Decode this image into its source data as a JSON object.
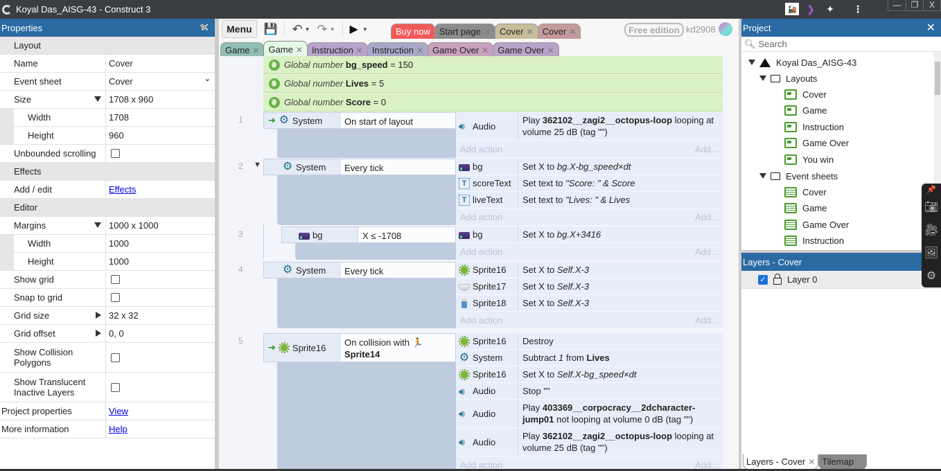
{
  "window": {
    "title": "Koyal Das_AISG-43 - Construct 3",
    "controls": [
      "minimize",
      "restore",
      "close"
    ]
  },
  "properties_panel": {
    "title": "Properties",
    "rows": [
      {
        "type": "section",
        "label": "Layout"
      },
      {
        "label": "Name",
        "value": "Cover"
      },
      {
        "label": "Event sheet",
        "value": "Cover",
        "control": "dropdown"
      },
      {
        "label": "Size",
        "value": "1708 x 960",
        "expander": "expanded"
      },
      {
        "label": "Width",
        "value": "1708",
        "sub": true
      },
      {
        "label": "Height",
        "value": "960",
        "sub": true
      },
      {
        "label": "Unbounded scrolling",
        "value": false,
        "control": "checkbox"
      },
      {
        "type": "section",
        "label": "Effects"
      },
      {
        "label": "Add / edit",
        "value": "Effects",
        "control": "link"
      },
      {
        "type": "section",
        "label": "Editor"
      },
      {
        "label": "Margins",
        "value": "1000 x 1000",
        "expander": "expanded"
      },
      {
        "label": "Width",
        "value": "1000",
        "sub": true
      },
      {
        "label": "Height",
        "value": "1000",
        "sub": true
      },
      {
        "label": "Show grid",
        "value": false,
        "control": "checkbox"
      },
      {
        "label": "Snap to grid",
        "value": false,
        "control": "checkbox"
      },
      {
        "label": "Grid size",
        "value": "32 x 32",
        "expander": "collapsed"
      },
      {
        "label": "Grid offset",
        "value": "0, 0",
        "expander": "collapsed"
      },
      {
        "label": "Show Collision Polygons",
        "value": false,
        "control": "checkbox"
      },
      {
        "label": "Show Translucent Inactive Layers",
        "value": false,
        "control": "checkbox"
      },
      {
        "label": "Project properties",
        "value": "View",
        "control": "link",
        "top": true
      },
      {
        "label": "More information",
        "value": "Help",
        "control": "link",
        "top": true
      }
    ]
  },
  "toolbar": {
    "menu_label": "Menu",
    "free_edition": "Free edition",
    "username": "kd2908"
  },
  "top_tabs": [
    {
      "label": "Buy now",
      "color": "#f25a5a",
      "closable": false,
      "text_color": "#ffffff"
    },
    {
      "label": "Start page",
      "color": "#8c8c8c",
      "closable": true
    },
    {
      "label": "Cover",
      "color": "#c8bd9a",
      "closable": true
    },
    {
      "label": "Cover",
      "color": "#c39a9a",
      "closable": true
    }
  ],
  "doc_tabs": [
    {
      "label": "Game",
      "color": "#8fbfb5",
      "active": false
    },
    {
      "label": "Game",
      "color": "#e6f9e6",
      "active": true
    },
    {
      "label": "Instruction",
      "color": "#b8a3cc",
      "active": false
    },
    {
      "label": "Instruction",
      "color": "#a9a8c9",
      "active": false
    },
    {
      "label": "Game Over",
      "color": "#c9a0be",
      "active": false
    },
    {
      "label": "Game Over",
      "color": "#b9a3c8",
      "active": false
    }
  ],
  "globals": [
    {
      "prefix": "Global number",
      "name": "bg_speed",
      "value": "= 150"
    },
    {
      "prefix": "Global number",
      "name": "Lives",
      "value": "= 5"
    },
    {
      "prefix": "Global number",
      "name": "Score",
      "value": "= 0"
    }
  ],
  "events": [
    {
      "num": "1",
      "trigger": true,
      "cond_obj": "System",
      "cond_icon": "gear",
      "cond": "On start of layout",
      "actions": [
        {
          "icon": "audio",
          "obj": "Audio",
          "pre": "Play ",
          "bold": "362102__zagi2__octopus-loop",
          "post": " looping at volume 25 dB (tag \"\")"
        }
      ]
    },
    {
      "num": "2",
      "collapsible": true,
      "cond_obj": "System",
      "cond_icon": "gear",
      "cond": "Every tick",
      "actions": [
        {
          "icon": "bg",
          "obj": "bg",
          "pre": "Set X to ",
          "italic": "bg.X-bg_speed×dt"
        },
        {
          "icon": "text",
          "obj": "scoreText",
          "pre": "Set text to ",
          "italic": "\"Score: \" & Score"
        },
        {
          "icon": "text",
          "obj": "liveText",
          "pre": "Set text to ",
          "italic": "\"Lives: \" & Lives"
        }
      ]
    },
    {
      "num": "3",
      "sub": true,
      "cond_obj": "bg",
      "cond_icon": "bg",
      "cond": "X ≤ -1708",
      "actions": [
        {
          "icon": "bg",
          "obj": "bg",
          "pre": "Set X to ",
          "italic": "bg.X+3416"
        }
      ]
    },
    {
      "num": "4",
      "cond_obj": "System",
      "cond_icon": "gear",
      "cond": "Every tick",
      "actions": [
        {
          "icon": "virus",
          "obj": "Sprite16",
          "pre": "Set X to ",
          "italic": "Self.X-3"
        },
        {
          "icon": "mask",
          "obj": "Sprite17",
          "pre": "Set X to ",
          "italic": "Self.X-3"
        },
        {
          "icon": "bottle",
          "obj": "Sprite18",
          "pre": "Set X to ",
          "italic": "Self.X-3"
        }
      ]
    },
    {
      "num": "5",
      "trigger": true,
      "cond_obj": "Sprite16",
      "cond_icon": "virus",
      "cond": "On collision with",
      "cond_bold": "Sprite14",
      "actions": [
        {
          "icon": "virus",
          "obj": "Sprite16",
          "pre": "Destroy"
        },
        {
          "icon": "gear",
          "obj": "System",
          "pre": "Subtract ",
          "italic": "1",
          "post": " from ",
          "bold2": "Lives"
        },
        {
          "icon": "virus",
          "obj": "Sprite16",
          "pre": "Set X to ",
          "italic": "Self.X-bg_speed×dt"
        },
        {
          "icon": "audio",
          "obj": "Audio",
          "pre": "Stop \"\""
        },
        {
          "icon": "audio",
          "obj": "Audio",
          "pre": "Play ",
          "bold": "403369__corpocracy__2dcharacter-jump01",
          "post": " not looping at volume 0 dB (tag \"\")"
        },
        {
          "icon": "audio",
          "obj": "Audio",
          "pre": "Play ",
          "bold": "362102__zagi2__octopus-loop",
          "post": " looping at volume 25 dB (tag \"\")"
        }
      ]
    }
  ],
  "add_action_label": "Add action",
  "add_label": "Add...",
  "project_panel": {
    "title": "Project",
    "search_placeholder": "Search",
    "project_name": "Koyal Das_AISG-43",
    "layouts_folder": "Layouts",
    "layouts": [
      "Cover",
      "Game",
      "Instruction",
      "Game Over",
      "You win"
    ],
    "event_sheets_folder": "Event sheets",
    "event_sheets": [
      "Cover",
      "Game",
      "Game Over",
      "Instruction"
    ]
  },
  "layers_panel": {
    "title": "Layers - Cover",
    "layers": [
      {
        "name": "Layer 0",
        "visible": true,
        "locked": false
      }
    ]
  },
  "bottom_tabs": [
    {
      "label": "Layers - Cover",
      "active": true
    },
    {
      "label": "Tilemap",
      "active": false
    }
  ]
}
